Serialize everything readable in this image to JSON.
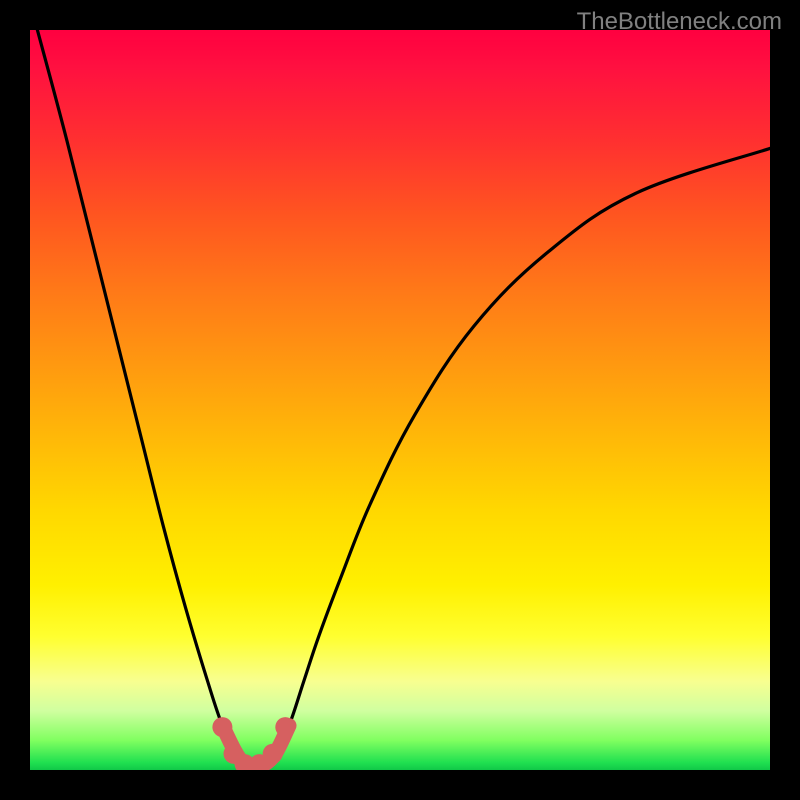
{
  "watermark": "TheBottleneck.com",
  "chart_data": {
    "type": "line",
    "title": "",
    "xlabel": "",
    "ylabel": "",
    "xlim": [
      0,
      100
    ],
    "ylim": [
      0,
      100
    ],
    "background": "rainbow-gradient-vertical",
    "series": [
      {
        "name": "bottleneck-curve",
        "color": "#000000",
        "x": [
          1,
          5,
          10,
          15,
          18,
          21,
          24,
          26,
          28,
          29.5,
          31,
          33,
          35,
          37,
          39,
          42,
          46,
          52,
          60,
          70,
          82,
          100
        ],
        "y": [
          100,
          85,
          65,
          45,
          33,
          22,
          12,
          6,
          2,
          0.5,
          0.5,
          2,
          6,
          12,
          18,
          26,
          36,
          48,
          60,
          70,
          78,
          84
        ]
      }
    ],
    "markers": [
      {
        "name": "dot-1",
        "x": 26.0,
        "y": 5.8,
        "color": "#d66060",
        "size": 10
      },
      {
        "name": "dot-2",
        "x": 27.5,
        "y": 2.2,
        "color": "#d66060",
        "size": 10
      },
      {
        "name": "dot-3",
        "x": 29.0,
        "y": 0.8,
        "color": "#d66060",
        "size": 10
      },
      {
        "name": "dot-4",
        "x": 31.0,
        "y": 0.8,
        "color": "#d66060",
        "size": 10
      },
      {
        "name": "dot-5",
        "x": 32.8,
        "y": 2.2,
        "color": "#d66060",
        "size": 10
      },
      {
        "name": "dot-6",
        "x": 34.5,
        "y": 5.8,
        "color": "#d66060",
        "size": 10
      }
    ]
  }
}
